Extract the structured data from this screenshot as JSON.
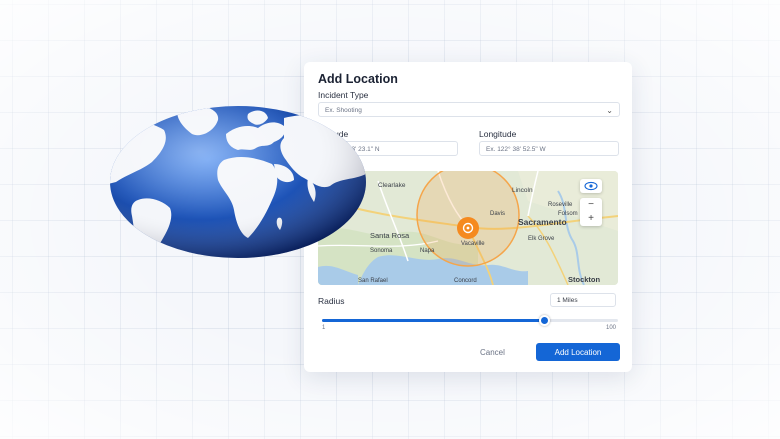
{
  "dialog": {
    "title": "Add Location",
    "incident_type": {
      "label": "Incident Type",
      "placeholder": "Ex. Shooting"
    },
    "latitude": {
      "label": "Latitude",
      "placeholder": "Ex. 38° 33' 23.1\" N"
    },
    "longitude": {
      "label": "Longitude",
      "placeholder": "Ex. 122° 38' 52.5\" W"
    },
    "map": {
      "places": [
        "Clearlake",
        "Lincoln",
        "Roseville",
        "Folsom",
        "Sacramento",
        "Santa Rosa",
        "Vacaville",
        "Elk Grove",
        "Sonoma",
        "Napa",
        "San Rafael",
        "Concord",
        "Stockton",
        "Davis"
      ],
      "zoom_in": "+",
      "zoom_out": "−"
    },
    "radius": {
      "label": "Radius",
      "value": "1 Miles",
      "min": "1",
      "max": "100",
      "fraction": 0.75
    },
    "cancel_label": "Cancel",
    "submit_label": "Add Location"
  },
  "colors": {
    "accent": "#1466d6",
    "marker": "#f58a1f",
    "globe_ocean": "#1e54b8"
  },
  "icons": {
    "select": "chevron-down-icon",
    "locate": "eye-target-icon",
    "marker": "map-pin-icon"
  }
}
